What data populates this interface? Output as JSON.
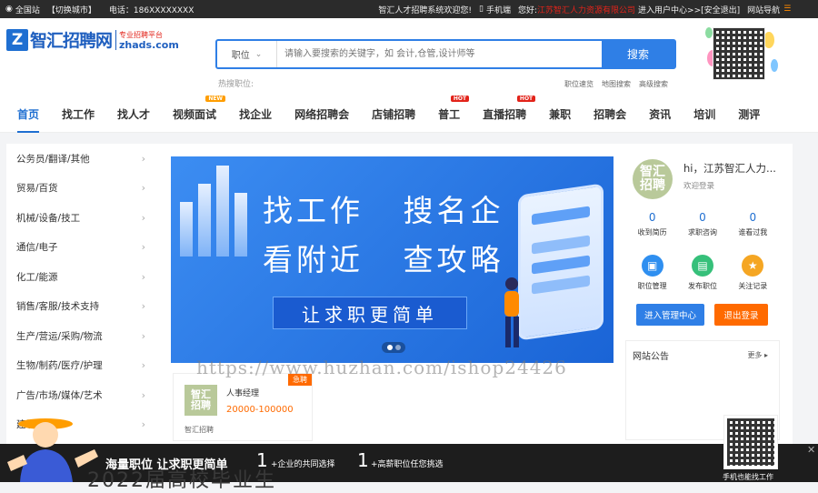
{
  "topbar": {
    "site": "全国站",
    "switch_city": "【切换城市】",
    "phone": "电话：186XXXXXXXX",
    "welcome": "智汇人才招聘系统欢迎您!",
    "mobile": "手机端",
    "greeting": "您好:",
    "company": "江苏智汇人力资源有限公司",
    "user_center": "进入用户中心>>",
    "logout": "[安全退出]",
    "site_nav": "网站导航"
  },
  "logo": {
    "name": "智汇招聘网",
    "slogan": "专业招聘平台",
    "domain": "zhads.com"
  },
  "search": {
    "category": "职位",
    "placeholder": "请输入要搜索的关键字，如 会计,仓管,设计师等",
    "button": "搜索",
    "hot_label": "热搜职位:",
    "links": [
      "职位速览",
      "地图搜索",
      "高级搜索"
    ]
  },
  "nav": [
    {
      "label": "首页",
      "badge": "",
      "active": true
    },
    {
      "label": "找工作",
      "badge": ""
    },
    {
      "label": "找人才",
      "badge": ""
    },
    {
      "label": "视频面试",
      "badge": "NEW"
    },
    {
      "label": "找企业",
      "badge": ""
    },
    {
      "label": "网络招聘会",
      "badge": ""
    },
    {
      "label": "店铺招聘",
      "badge": ""
    },
    {
      "label": "普工",
      "badge": "HOT"
    },
    {
      "label": "直播招聘",
      "badge": "HOT"
    },
    {
      "label": "兼职",
      "badge": ""
    },
    {
      "label": "招聘会",
      "badge": ""
    },
    {
      "label": "资讯",
      "badge": ""
    },
    {
      "label": "培训",
      "badge": ""
    },
    {
      "label": "测评",
      "badge": ""
    }
  ],
  "categories": [
    "公务员/翻译/其他",
    "贸易/百货",
    "机械/设备/技工",
    "通信/电子",
    "化工/能源",
    "销售/客服/技术支持",
    "生产/营运/采购/物流",
    "生物/制药/医疗/护理",
    "广告/市场/媒体/艺术",
    "建筑/房产"
  ],
  "banner": {
    "line1": "找工作   搜名企",
    "line2": "看附近   查攻略",
    "slogan": "让求职更简单"
  },
  "profile": {
    "avatar_text": "智汇招聘",
    "greeting": "hi，江苏智汇人力...",
    "welcome": "欢迎登录",
    "stats": [
      {
        "value": "0",
        "label": "收到简历"
      },
      {
        "value": "0",
        "label": "求职咨询"
      },
      {
        "value": "0",
        "label": "谁看过我"
      }
    ],
    "actions": [
      {
        "label": "职位管理",
        "icon": "briefcase-icon",
        "color": "#2f8ff0"
      },
      {
        "label": "发布职位",
        "icon": "document-icon",
        "color": "#36c07a"
      },
      {
        "label": "关注记录",
        "icon": "star-icon",
        "color": "#f5a623"
      }
    ],
    "admin_button": "进入管理中心",
    "logout_button": "退出登录"
  },
  "notice": {
    "title": "网站公告",
    "more": "更多"
  },
  "job": {
    "tag": "急聘",
    "logo_text": "智汇招聘",
    "position": "人事经理",
    "salary": "20000-100000",
    "company": "智汇招聘"
  },
  "watermark": "https://www.huzhan.com/ishop24426",
  "footer": {
    "main": "海量职位 让求职更简单",
    "num1": "1",
    "text1": "+企业的共同选择",
    "num2": "1",
    "text2": "+高薪职位任您挑选",
    "ghost": "2022届高校毕业生",
    "qr_label": "手机也能找工作",
    "close": "✕"
  },
  "colors": {
    "brand_blue": "#1f6fd1",
    "search_blue": "#2f7fe6",
    "orange": "#ff6a00",
    "topbar_bg": "#2b2b2b"
  }
}
